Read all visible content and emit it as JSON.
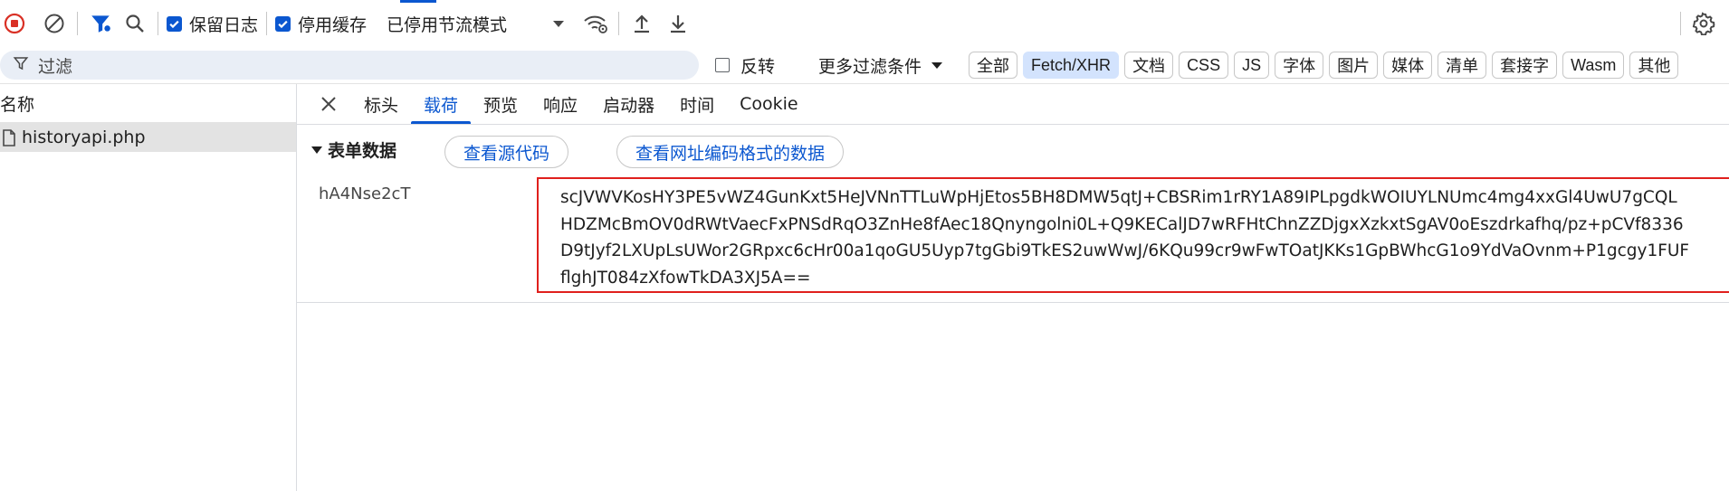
{
  "toolbar": {
    "preserve_log_label": "保留日志",
    "disable_cache_label": "停用缓存",
    "throttling_value": "已停用节流模式",
    "icons": [
      "stop-recording-icon",
      "clear-icon",
      "filter-icon",
      "search-icon",
      "network-conditions-icon",
      "import-icon",
      "export-icon",
      "settings-icon"
    ]
  },
  "filterbar": {
    "filter_placeholder": "过滤",
    "invert_label": "反转",
    "more_filters_label": "更多过滤条件",
    "types": [
      "全部",
      "Fetch/XHR",
      "文档",
      "CSS",
      "JS",
      "字体",
      "图片",
      "媒体",
      "清单",
      "套接字",
      "Wasm",
      "其他"
    ],
    "active_type": "Fetch/XHR"
  },
  "requests": {
    "column_name": "名称",
    "items": [
      {
        "name": "historyapi.php"
      }
    ]
  },
  "detail": {
    "tabs": [
      "标头",
      "载荷",
      "预览",
      "响应",
      "启动器",
      "时间",
      "Cookie"
    ],
    "active_tab": "载荷",
    "form_section_title": "表单数据",
    "view_source_label": "查看源代码",
    "view_url_encoded_label": "查看网址编码格式的数据",
    "field_key": "hA4Nse2cT",
    "field_value_lines": [
      "scJVWVKosHY3PE5vWZ4GunKxt5HeJVNnTTLuWpHjEtos5BH8DMW5qtJ+CBSRim1rRY1A89IPLpgdkWOIUYLNUmc4mg4xxGl4UwU7gCQL",
      "HDZMcBmOV0dRWtVaecFxPNSdRqO3ZnHe8fAec18Qnyngolni0L+Q9KECalJD7wRFHtChnZZDjgxXzkxtSgAV0oEszdrkafhq/pz+pCVf8336",
      "D9tJyf2LXUpLsUWor2GRpxc6cHr00a1qoGU5Uyp7tgGbi9TkES2uwWwJ/6KQu99cr9wFwTOatJKKs1GpBWhcG1o9YdVaOvnm+P1gcgy1FUF",
      "flghJT084zXfowTkDA3XJ5A=="
    ]
  },
  "colors": {
    "accent": "#0b57d0",
    "record_stop": "#d93025",
    "highlight_box": "#e0201d"
  }
}
